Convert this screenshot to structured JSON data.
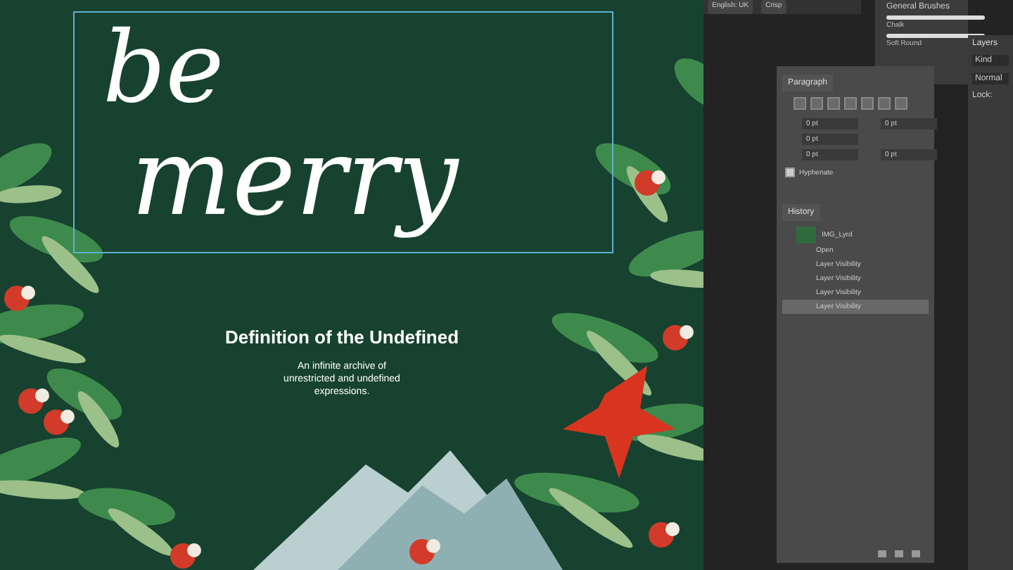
{
  "poster": {
    "headline_lines": [
      "be",
      "merry"
    ],
    "title": "Definition of the Undefined",
    "subtitle": "An infinite archive of unrestricted and undefined expressions."
  },
  "options_bar": {
    "language": "English: UK",
    "antialias": "Crisp"
  },
  "brushes_panel": {
    "group": "General Brushes",
    "brushes": [
      "Chalk",
      "Soft Round"
    ]
  },
  "paragraph_panel": {
    "tab": "Paragraph",
    "fields": [
      "0 pt",
      "0 pt",
      "0 pt",
      "0 pt",
      "0 pt"
    ],
    "hyphenate": {
      "label": "Hyphenate",
      "checked": true
    }
  },
  "history_panel": {
    "tab": "History",
    "snapshot": "IMG_Lyrd",
    "items": [
      {
        "label": "Open",
        "selected": false
      },
      {
        "label": "Layer Visibility",
        "selected": false
      },
      {
        "label": "Layer Visibility",
        "selected": false
      },
      {
        "label": "Layer Visibility",
        "selected": false
      },
      {
        "label": "Layer Visibility",
        "selected": true
      }
    ]
  },
  "layers_panel": {
    "tab": "Layers",
    "search": "Kind",
    "blend": "Normal",
    "lock": "Lock:"
  }
}
